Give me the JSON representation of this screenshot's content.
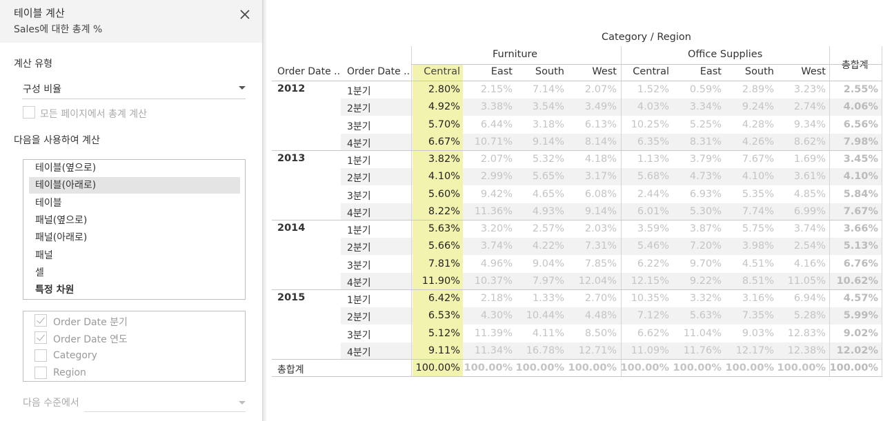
{
  "panel": {
    "title": "테이블 계산",
    "subtitle": "Sales에 대한 총계 %",
    "close_icon": "close-icon",
    "calc_type_label": "계산 유형",
    "calc_type_value": "구성 비율",
    "all_pages_label": "모든 페이지에서 총계 계산",
    "compute_using_label": "다음을 사용하여 계산",
    "compute_options": [
      "테이블(옆으로)",
      "테이블(아래로)",
      "테이블",
      "패널(옆으로)",
      "패널(아래로)",
      "패널",
      "셀",
      "특정 차원"
    ],
    "compute_selected": "테이블(아래로)",
    "dimensions": [
      {
        "label": "Order Date 분기",
        "checked": true
      },
      {
        "label": "Order Date 연도",
        "checked": true
      },
      {
        "label": "Category",
        "checked": false
      },
      {
        "label": "Region",
        "checked": false
      }
    ],
    "level_label": "다음 수준에서",
    "level_value": ""
  },
  "table": {
    "top_header": "Category  /  Region",
    "categories": [
      "Furniture",
      "Office Supplies"
    ],
    "row_headers": [
      "Order Date ..",
      "Order Date .."
    ],
    "regions": [
      "Central",
      "East",
      "South",
      "West",
      "Central",
      "East",
      "South",
      "West"
    ],
    "grand_total_label": "총합계",
    "highlight_color": "#f3f3b0",
    "years": [
      "2012",
      "2013",
      "2014",
      "2015"
    ],
    "quarters": [
      "1분기",
      "2분기",
      "3분기",
      "4분기"
    ],
    "rows": [
      [
        "2.80%",
        "2.15%",
        "7.14%",
        "2.07%",
        "1.52%",
        "0.59%",
        "2.89%",
        "3.23%",
        "2.55%"
      ],
      [
        "4.92%",
        "3.38%",
        "3.54%",
        "3.49%",
        "4.03%",
        "3.34%",
        "9.24%",
        "2.74%",
        "4.06%"
      ],
      [
        "5.70%",
        "6.44%",
        "3.18%",
        "6.13%",
        "10.25%",
        "5.25%",
        "4.28%",
        "9.34%",
        "6.56%"
      ],
      [
        "6.67%",
        "10.71%",
        "9.14%",
        "8.14%",
        "6.35%",
        "8.31%",
        "4.26%",
        "8.62%",
        "7.98%"
      ],
      [
        "3.82%",
        "2.07%",
        "5.32%",
        "4.18%",
        "1.13%",
        "3.79%",
        "7.67%",
        "1.69%",
        "3.45%"
      ],
      [
        "4.10%",
        "2.99%",
        "5.65%",
        "3.17%",
        "5.68%",
        "4.73%",
        "4.10%",
        "3.61%",
        "4.10%"
      ],
      [
        "5.60%",
        "9.42%",
        "4.65%",
        "6.08%",
        "2.44%",
        "6.93%",
        "5.35%",
        "4.85%",
        "5.84%"
      ],
      [
        "8.22%",
        "11.36%",
        "4.93%",
        "9.14%",
        "6.01%",
        "5.30%",
        "7.74%",
        "6.99%",
        "7.67%"
      ],
      [
        "5.63%",
        "3.20%",
        "2.57%",
        "2.03%",
        "3.59%",
        "3.87%",
        "5.75%",
        "3.74%",
        "3.66%"
      ],
      [
        "5.66%",
        "3.74%",
        "4.22%",
        "7.31%",
        "5.46%",
        "7.20%",
        "3.98%",
        "2.54%",
        "5.13%"
      ],
      [
        "7.81%",
        "4.96%",
        "9.04%",
        "7.85%",
        "6.22%",
        "9.70%",
        "4.51%",
        "4.16%",
        "6.76%"
      ],
      [
        "11.90%",
        "10.37%",
        "7.97%",
        "12.04%",
        "12.15%",
        "9.22%",
        "8.51%",
        "11.05%",
        "10.62%"
      ],
      [
        "6.42%",
        "2.18%",
        "1.33%",
        "2.70%",
        "10.35%",
        "3.32%",
        "3.16%",
        "6.94%",
        "4.57%"
      ],
      [
        "6.53%",
        "4.30%",
        "10.44%",
        "4.48%",
        "7.12%",
        "5.63%",
        "7.35%",
        "5.28%",
        "5.99%"
      ],
      [
        "5.12%",
        "11.39%",
        "4.11%",
        "8.50%",
        "6.62%",
        "11.04%",
        "9.03%",
        "12.83%",
        "9.02%"
      ],
      [
        "9.11%",
        "11.34%",
        "16.78%",
        "12.71%",
        "11.09%",
        "11.76%",
        "12.17%",
        "12.38%",
        "12.02%"
      ]
    ],
    "grand_totals": [
      "100.00%",
      "100.00%",
      "100.00%",
      "100.00%",
      "100.00%",
      "100.00%",
      "100.00%",
      "100.00%",
      "100.00%"
    ]
  }
}
